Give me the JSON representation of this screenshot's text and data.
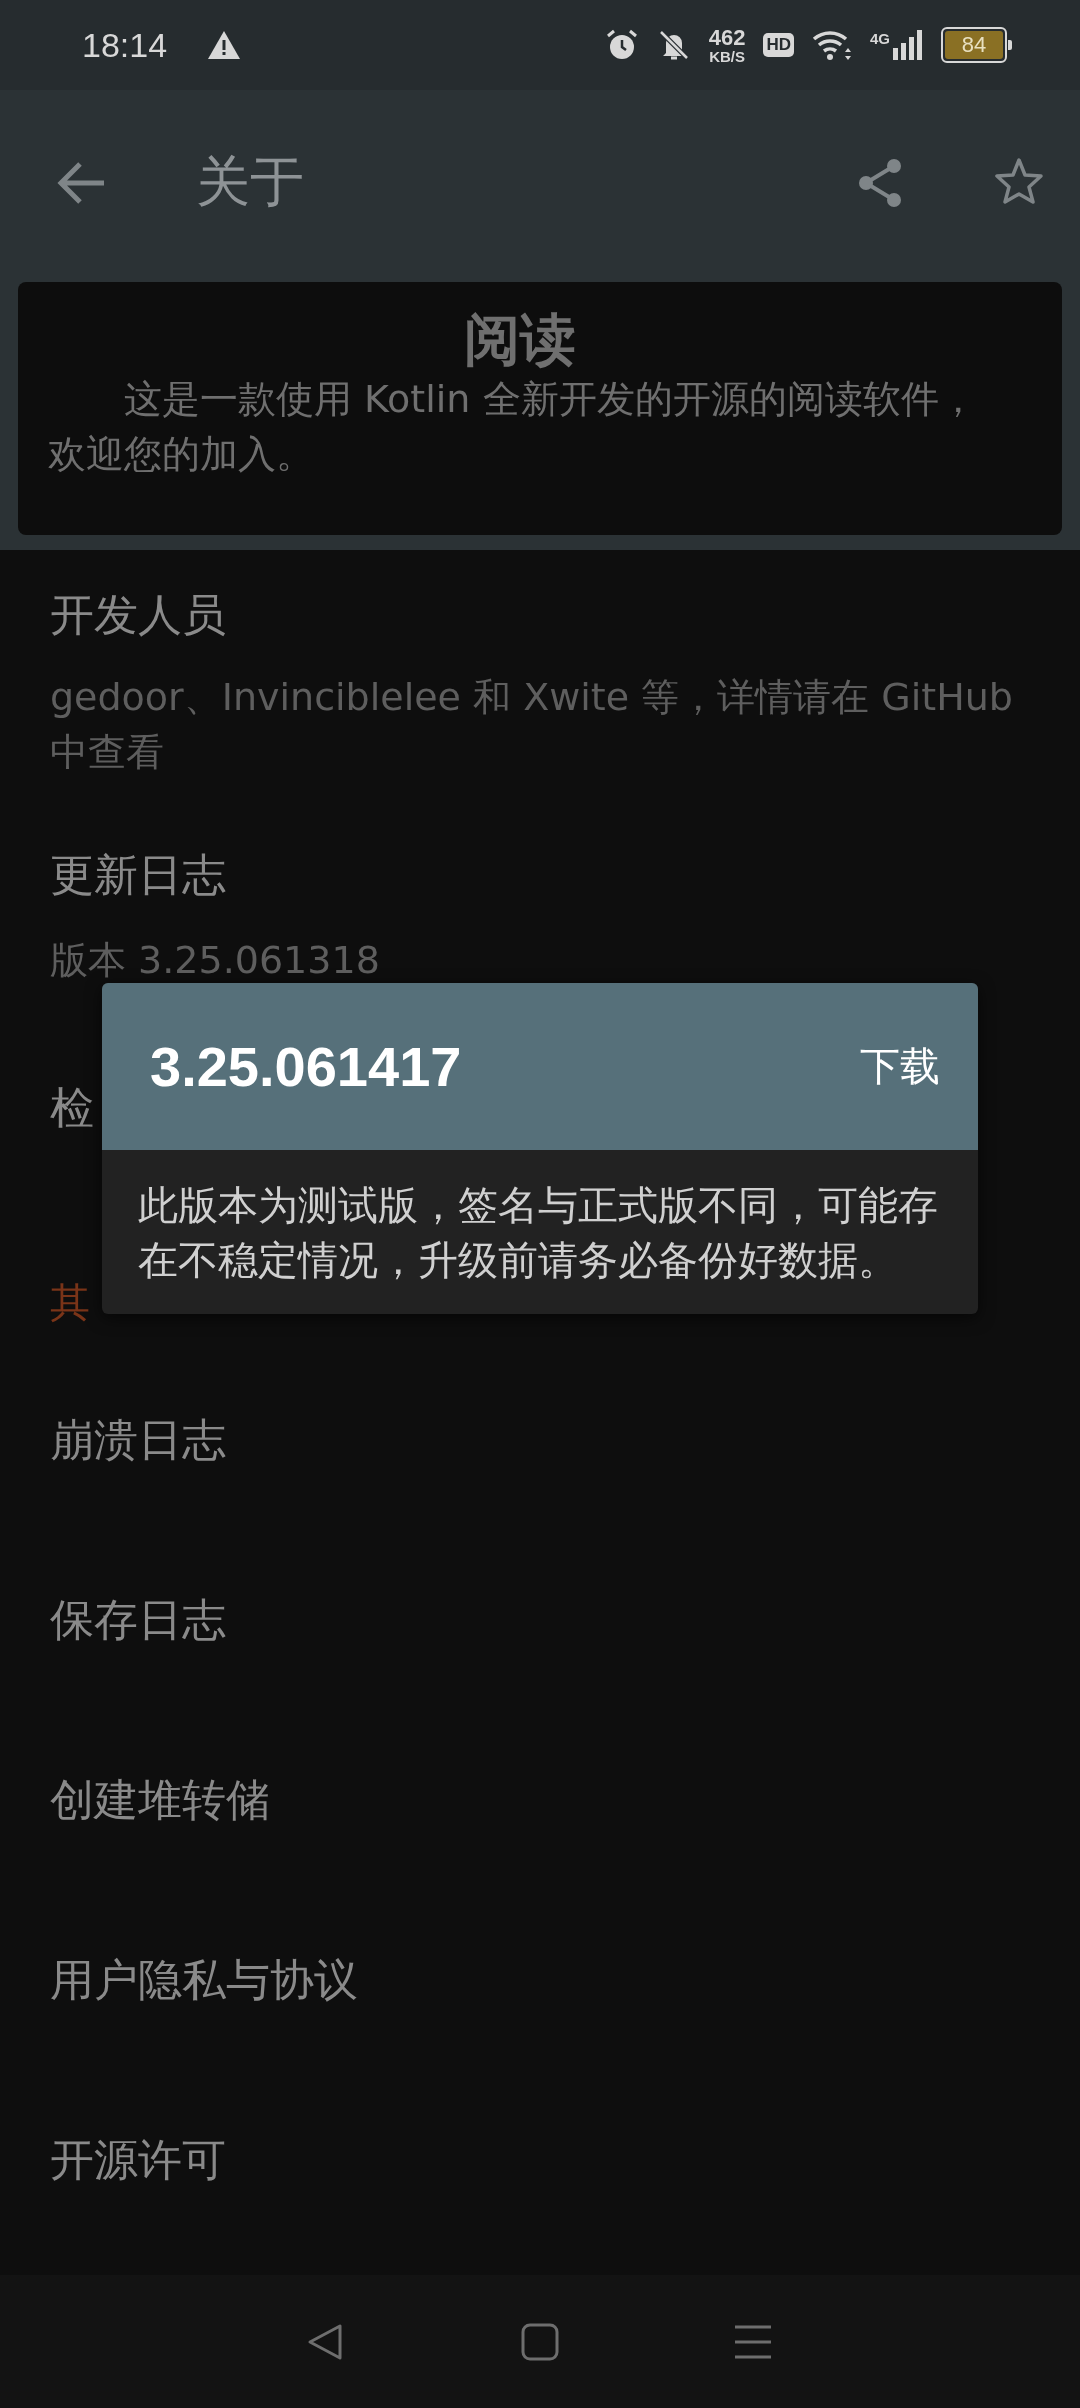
{
  "status_bar": {
    "time": "18:14",
    "speed_value": "462",
    "speed_unit": "KB/S",
    "hd": "HD",
    "network": "4G",
    "battery": "84"
  },
  "toolbar": {
    "title": "关于"
  },
  "app_card": {
    "name": "阅读",
    "description": "这是一款使用 Kotlin 全新开发的开源的阅读软件，欢迎您的加入。"
  },
  "items": [
    {
      "kind": "detail",
      "title": "开发人员",
      "subtitle": "gedoor、Invinciblelee 和 Xwite 等，详情请在 GitHub 中查看"
    },
    {
      "kind": "detail",
      "title": "更新日志",
      "subtitle": "版本 3.25.061318"
    },
    {
      "kind": "plain",
      "title": "检"
    },
    {
      "kind": "category",
      "title": "其"
    },
    {
      "kind": "plain",
      "title": "崩溃日志"
    },
    {
      "kind": "plain",
      "title": "保存日志"
    },
    {
      "kind": "plain",
      "title": "创建堆转储"
    },
    {
      "kind": "plain",
      "title": "用户隐私与协议"
    },
    {
      "kind": "plain",
      "title": "开源许可"
    }
  ],
  "dialog": {
    "title": "3.25.061417",
    "action": "下载",
    "message": "此版本为测试版，签名与正式版不同，可能存在不稳定情况，升级前请务必备份好数据。"
  }
}
